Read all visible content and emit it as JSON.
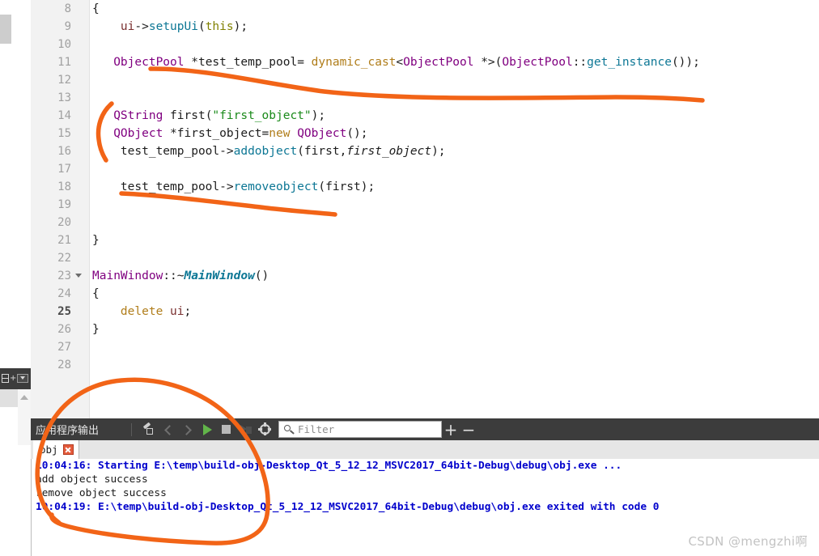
{
  "editor": {
    "lines": [
      {
        "no": "8",
        "current": false,
        "fold": false,
        "tokens": [
          {
            "t": "{",
            "c": "plain",
            "indent": 0
          }
        ]
      },
      {
        "no": "9",
        "current": false,
        "fold": false,
        "tokens": [
          {
            "t": "    ui",
            "c": "var"
          },
          {
            "t": "->",
            "c": "op"
          },
          {
            "t": "setupUi",
            "c": "fn"
          },
          {
            "t": "(",
            "c": "op"
          },
          {
            "t": "this",
            "c": "kw2"
          },
          {
            "t": ");",
            "c": "op"
          }
        ]
      },
      {
        "no": "10",
        "current": false,
        "fold": false,
        "tokens": []
      },
      {
        "no": "11",
        "current": false,
        "fold": false,
        "tokens": [
          {
            "t": "   ",
            "c": "plain"
          },
          {
            "t": "ObjectPool",
            "c": "type"
          },
          {
            "t": " *test_temp_pool= ",
            "c": "plain"
          },
          {
            "t": "dynamic_cast",
            "c": "kw"
          },
          {
            "t": "<",
            "c": "plain"
          },
          {
            "t": "ObjectPool",
            "c": "type"
          },
          {
            "t": " *>(",
            "c": "plain"
          },
          {
            "t": "ObjectPool",
            "c": "type"
          },
          {
            "t": "::",
            "c": "plain"
          },
          {
            "t": "get_instance",
            "c": "fn"
          },
          {
            "t": "());",
            "c": "plain"
          }
        ]
      },
      {
        "no": "12",
        "current": false,
        "fold": false,
        "tokens": []
      },
      {
        "no": "13",
        "current": false,
        "fold": false,
        "tokens": []
      },
      {
        "no": "14",
        "current": false,
        "fold": false,
        "tokens": [
          {
            "t": "   ",
            "c": "plain"
          },
          {
            "t": "QString",
            "c": "type"
          },
          {
            "t": " first(",
            "c": "plain"
          },
          {
            "t": "\"first_object\"",
            "c": "str"
          },
          {
            "t": ");",
            "c": "plain"
          }
        ]
      },
      {
        "no": "15",
        "current": false,
        "fold": false,
        "tokens": [
          {
            "t": "   ",
            "c": "plain"
          },
          {
            "t": "QObject",
            "c": "type"
          },
          {
            "t": " *first_object=",
            "c": "plain"
          },
          {
            "t": "new",
            "c": "kw"
          },
          {
            "t": " ",
            "c": "plain"
          },
          {
            "t": "QObject",
            "c": "type"
          },
          {
            "t": "();",
            "c": "plain"
          }
        ]
      },
      {
        "no": "16",
        "current": false,
        "fold": false,
        "tokens": [
          {
            "t": "    test_temp_pool",
            "c": "plain"
          },
          {
            "t": "->",
            "c": "plain"
          },
          {
            "t": "addobject",
            "c": "fn"
          },
          {
            "t": "(first,",
            "c": "plain"
          },
          {
            "t": "first_object",
            "c": "it"
          },
          {
            "t": ");",
            "c": "plain"
          }
        ]
      },
      {
        "no": "17",
        "current": false,
        "fold": false,
        "tokens": []
      },
      {
        "no": "18",
        "current": false,
        "fold": false,
        "tokens": [
          {
            "t": "    test_temp_pool",
            "c": "plain"
          },
          {
            "t": "->",
            "c": "plain"
          },
          {
            "t": "removeobject",
            "c": "fn"
          },
          {
            "t": "(first);",
            "c": "plain"
          }
        ]
      },
      {
        "no": "19",
        "current": false,
        "fold": false,
        "tokens": []
      },
      {
        "no": "20",
        "current": false,
        "fold": false,
        "tokens": []
      },
      {
        "no": "21",
        "current": false,
        "fold": false,
        "tokens": [
          {
            "t": "}",
            "c": "plain"
          }
        ]
      },
      {
        "no": "22",
        "current": false,
        "fold": false,
        "tokens": []
      },
      {
        "no": "23",
        "current": false,
        "fold": true,
        "tokens": [
          {
            "t": "MainWindow",
            "c": "type"
          },
          {
            "t": "::~",
            "c": "plain"
          },
          {
            "t": "MainWindow",
            "c": "fn-it"
          },
          {
            "t": "()",
            "c": "plain"
          }
        ]
      },
      {
        "no": "24",
        "current": false,
        "fold": false,
        "tokens": [
          {
            "t": "{",
            "c": "plain"
          }
        ]
      },
      {
        "no": "25",
        "current": true,
        "fold": false,
        "tokens": [
          {
            "t": "    ",
            "c": "plain"
          },
          {
            "t": "delete",
            "c": "kw"
          },
          {
            "t": " ",
            "c": "plain"
          },
          {
            "t": "ui",
            "c": "var"
          },
          {
            "t": ";",
            "c": "plain"
          }
        ]
      },
      {
        "no": "26",
        "current": false,
        "fold": false,
        "tokens": [
          {
            "t": "}",
            "c": "plain"
          }
        ]
      },
      {
        "no": "27",
        "current": false,
        "fold": false,
        "tokens": []
      },
      {
        "no": "28",
        "current": false,
        "fold": false,
        "tokens": []
      }
    ]
  },
  "output_pane": {
    "title": "应用程序输出",
    "toolbar": {
      "clean_label": "clean-pane",
      "prev_label": "previous-item",
      "next_label": "next-item",
      "run_label": "run",
      "stop_label": "stop",
      "rerun_label": "re-run",
      "settings_label": "settings",
      "zoom_in_label": "+",
      "zoom_out_label": "−"
    },
    "filter": {
      "placeholder": "Filter",
      "value": ""
    },
    "tabs": [
      {
        "label": "obj",
        "closable": true,
        "active": true
      }
    ],
    "lines": [
      {
        "text": "10:04:16: Starting E:\\temp\\build-obj-Desktop_Qt_5_12_12_MSVC2017_64bit-Debug\\debug\\obj.exe ...",
        "kind": "sys"
      },
      {
        "text": "add object success",
        "kind": "plain"
      },
      {
        "text": "remove object success",
        "kind": "plain"
      },
      {
        "text": "10:04:19: E:\\temp\\build-obj-Desktop_Qt_5_12_12_MSVC2017_64bit-Debug\\debug\\obj.exe exited with code 0",
        "kind": "sys"
      }
    ]
  },
  "left_toolbar": {
    "split_label": "split-editor",
    "menu_label": "editor-menu"
  },
  "watermark": {
    "text": "CSDN @mengzhi啊"
  },
  "annotations": {
    "color": "#F26417",
    "marks": [
      {
        "name": "underline-objectpool-line"
      },
      {
        "name": "brace-block-marker"
      },
      {
        "name": "underline-removeobject-line"
      },
      {
        "name": "circle-output-region"
      }
    ]
  },
  "colors": {
    "accent_orange": "#F26417",
    "header_dark": "#3C3C3C",
    "gutter_gray": "#F2F2F2",
    "sys_blue": "#0000CC",
    "run_green": "#62B54A",
    "close_red": "#E45A3A"
  }
}
